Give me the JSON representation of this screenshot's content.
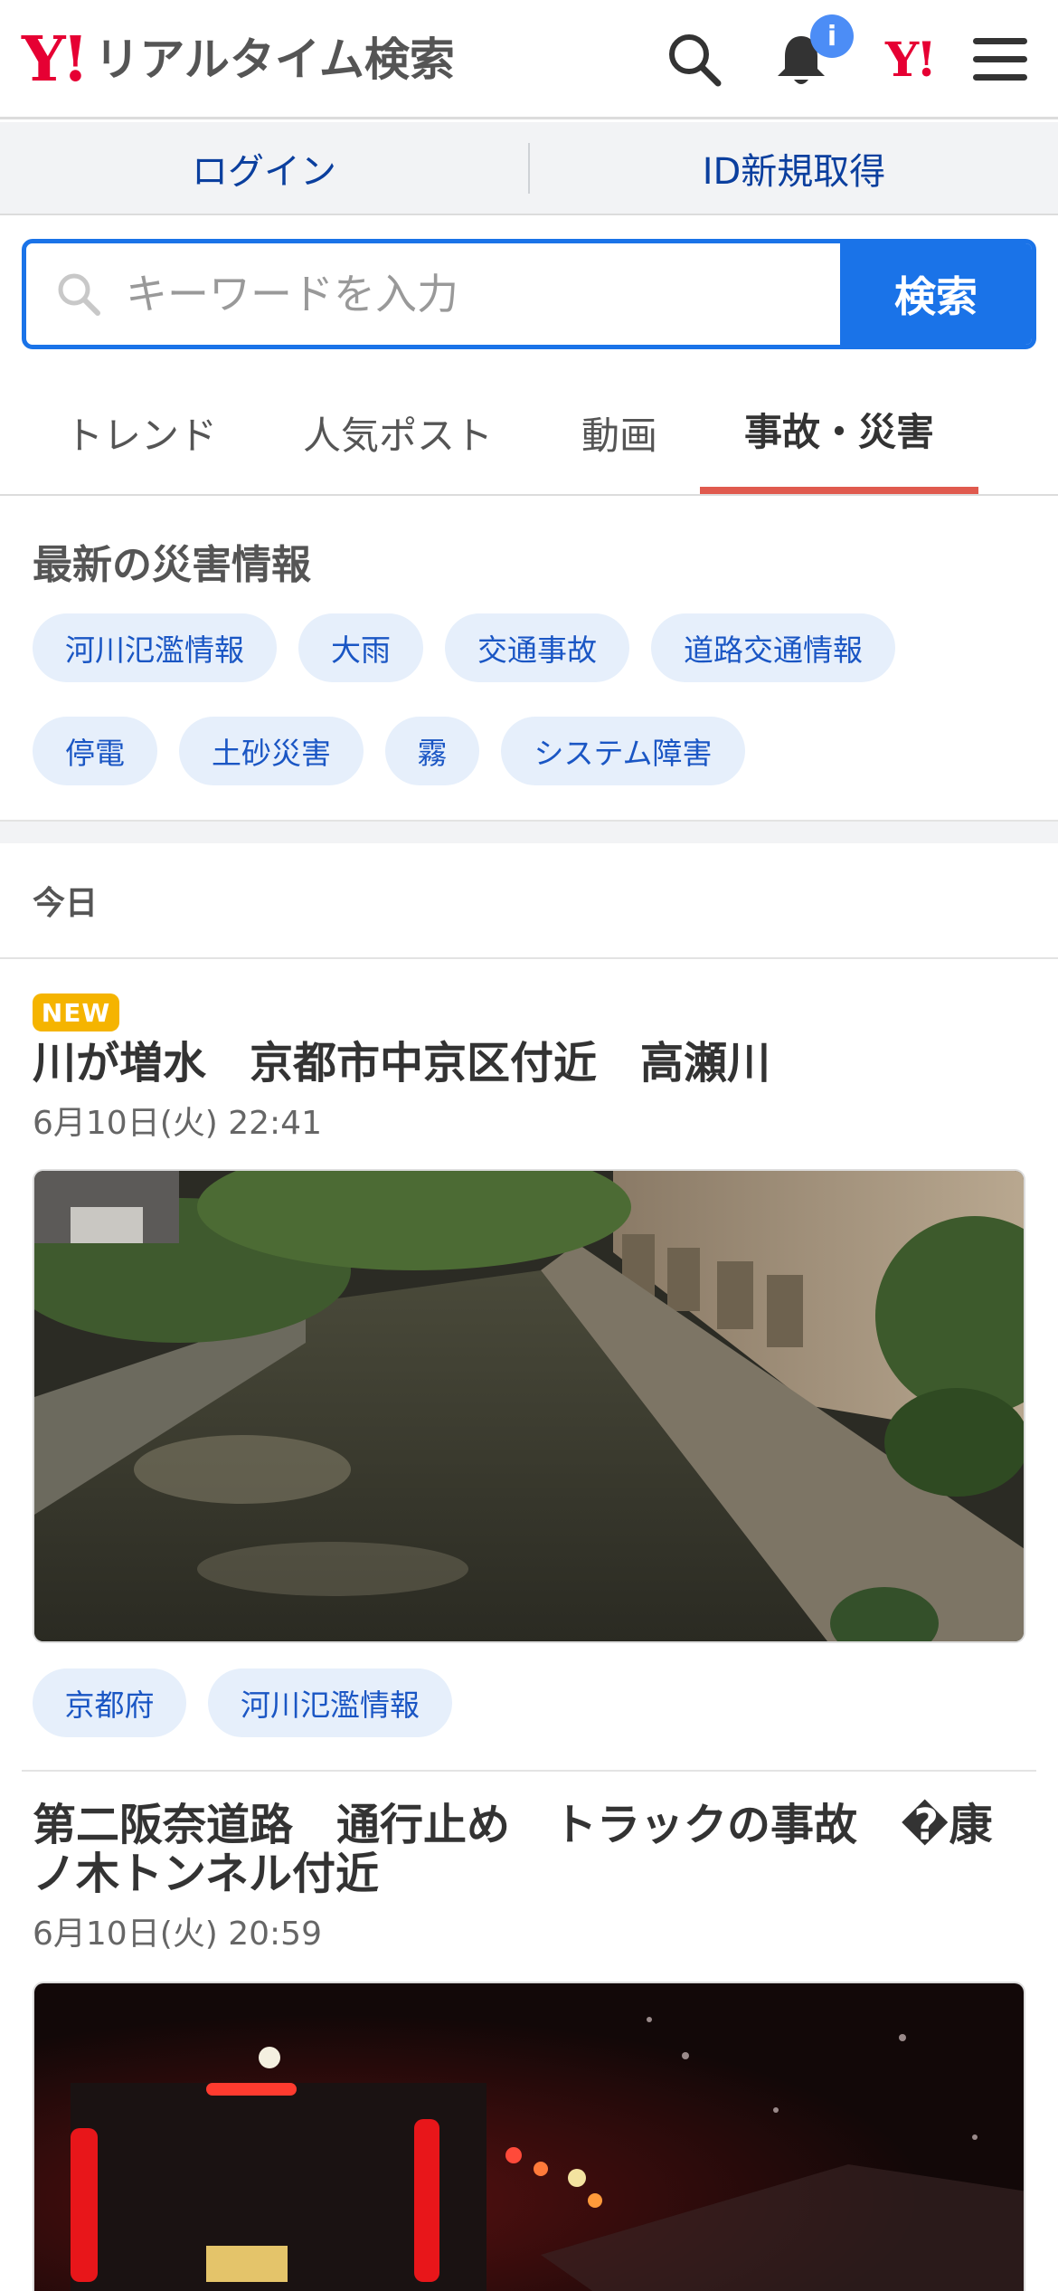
{
  "header": {
    "logo_mark": "Y!",
    "logo_text": "リアルタイム検索",
    "notification_badge": "i",
    "yj_mark": "Y!"
  },
  "account": {
    "login": "ログイン",
    "register": "ID新規取得"
  },
  "search": {
    "placeholder": "キーワードを入力",
    "button": "検索"
  },
  "tabs": [
    {
      "label": "トレンド"
    },
    {
      "label": "人気ポスト"
    },
    {
      "label": "動画"
    },
    {
      "label": "事故・災害",
      "active": true
    }
  ],
  "disaster": {
    "title": "最新の災害情報",
    "tags": [
      "河川氾濫情報",
      "大雨",
      "交通事故",
      "道路交通情報",
      "停電",
      "土砂災害",
      "霧",
      "システム障害"
    ]
  },
  "today_label": "今日",
  "articles": [
    {
      "badge": "NEW",
      "title": "川が増水　京都市中京区付近　高瀬川",
      "time": "6月10日(火) 22:41",
      "tags": [
        "京都府",
        "河川氾濫情報"
      ]
    },
    {
      "title": "第二阪奈道路　通行止め　トラックの事故　�康ノ木トンネル付近",
      "time": "6月10日(火) 20:59"
    }
  ],
  "colors": {
    "brand_red": "#e60033",
    "accent_blue": "#1a73e8",
    "active_tab": "#e05a4e",
    "new_badge": "#f5b400"
  }
}
